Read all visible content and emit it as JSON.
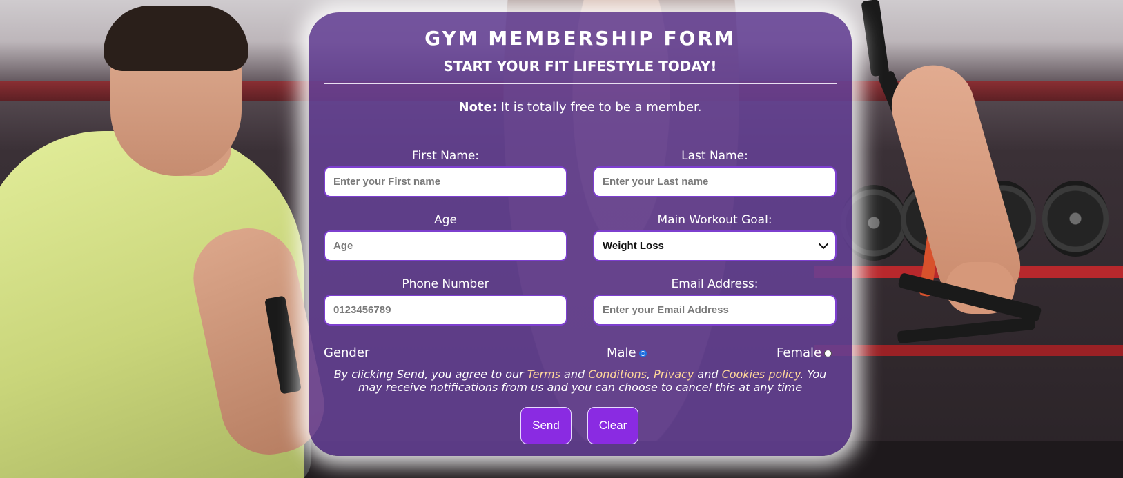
{
  "form": {
    "title": "GYM MEMBERSHIP FORM",
    "subtitle": "START YOUR FIT LIFESTYLE TODAY!",
    "note_label": "Note:",
    "note_text": " It is totally free to be a member.",
    "first_name": {
      "label": "First Name:",
      "placeholder": "Enter your First name"
    },
    "last_name": {
      "label": "Last Name:",
      "placeholder": "Enter your Last name"
    },
    "age": {
      "label": "Age",
      "placeholder": "Age"
    },
    "goal": {
      "label": "Main Workout Goal:",
      "selected": "Weight Loss"
    },
    "phone": {
      "label": "Phone Number",
      "placeholder": "0123456789"
    },
    "email": {
      "label": "Email Address:",
      "placeholder": "Enter your Email Address"
    },
    "gender": {
      "label": "Gender",
      "options": [
        {
          "label": "Male",
          "checked": true
        },
        {
          "label": "Female",
          "checked": false
        }
      ]
    },
    "consent": {
      "pre": "By clicking Send, you agree to our ",
      "terms": "Terms",
      "and1": " and ",
      "conditions": "Conditions",
      "comma": ", ",
      "privacy": "Privacy",
      "and2": " and ",
      "cookies": "Cookies policy",
      "post": ". You may receive notifications from us and you can choose to cancel this at any time"
    },
    "buttons": {
      "send": "Send",
      "clear": "Clear"
    }
  },
  "colors": {
    "card": "#6541966",
    "button": "#8a2be2",
    "link": "#ffd79a",
    "input_border": "#7d3fcf"
  }
}
